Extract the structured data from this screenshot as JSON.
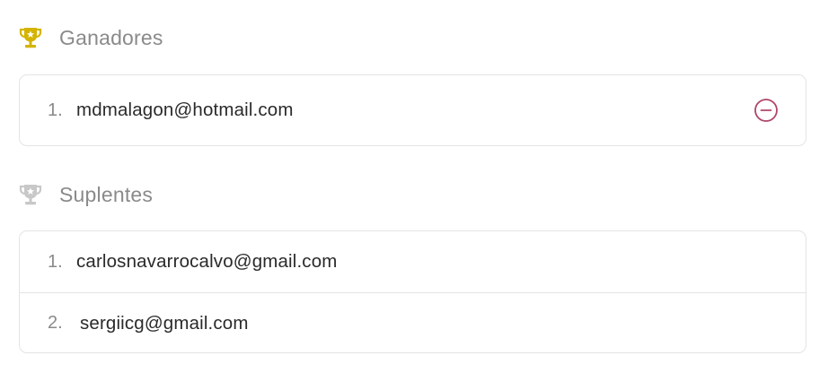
{
  "winners": {
    "title": "Ganadores",
    "icon": "trophy-icon",
    "icon_color": "#d4b400",
    "items": [
      {
        "number": "1.",
        "email": "mdmalagon@hotmail.com"
      }
    ],
    "remove_icon": "minus-circle-icon",
    "remove_color": "#b0456a"
  },
  "substitutes": {
    "title": "Suplentes",
    "icon": "trophy-icon",
    "icon_color": "#c8c8c8",
    "items": [
      {
        "number": "1.",
        "email": "carlosnavarrocalvo@gmail.com"
      },
      {
        "number": "2.",
        "email": "sergiicg@gmail.com"
      }
    ]
  }
}
